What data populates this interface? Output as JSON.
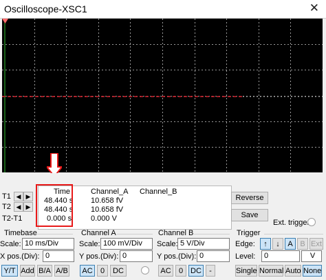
{
  "window": {
    "title": "Oscilloscope-XSC1",
    "close_glyph": "✕"
  },
  "cursors": {
    "t1_label": "T1",
    "t2_label": "T2",
    "t2t1_label": "T2-T1",
    "left_arrow": "◀",
    "right_arrow": "▶"
  },
  "readout": {
    "headers": [
      "Time",
      "Channel_A",
      "Channel_B"
    ],
    "rows": [
      {
        "time": "48.440 s",
        "channel_a": "10.658 fV",
        "channel_b": ""
      },
      {
        "time": "48.440 s",
        "channel_a": "10.658 fV",
        "channel_b": ""
      },
      {
        "time": "0.000 s",
        "channel_a": "0.000 V",
        "channel_b": ""
      }
    ]
  },
  "actions": {
    "reverse_label": "Reverse",
    "save_label": "Save",
    "ext_trigger_label": "Ext. trigger"
  },
  "timebase": {
    "title": "Timebase",
    "scale_label": "Scale:",
    "scale_value": "10 ms/Div",
    "xpos_label": "X pos.(Div):",
    "xpos_value": "0",
    "buttons": [
      "Y/T",
      "Add",
      "B/A",
      "A/B"
    ],
    "selected": "Y/T"
  },
  "channel_a": {
    "title": "Channel A",
    "scale_label": "Scale:",
    "scale_value": "100 mV/Div",
    "ypos_label": "Y pos.(Div):",
    "ypos_value": "0",
    "buttons": [
      "AC",
      "0",
      "DC"
    ],
    "selected": "AC"
  },
  "channel_b": {
    "title": "Channel B",
    "scale_label": "Scale:",
    "scale_value": "5  V/Div",
    "ypos_label": "Y pos.(Div):",
    "ypos_value": "0",
    "buttons": [
      "AC",
      "0",
      "DC",
      "-"
    ],
    "selected": "DC"
  },
  "trigger": {
    "title": "Trigger",
    "edge_label": "Edge:",
    "edge_buttons": [
      "↑",
      "↓",
      "A",
      "B",
      "Ext"
    ],
    "selected_source": "A",
    "level_label": "Level:",
    "level_value": "0",
    "level_unit": "V",
    "mode_buttons": [
      "Single",
      "Normal",
      "Auto",
      "None"
    ],
    "selected_mode": "None"
  },
  "colors": {
    "screen_bg": "#000000",
    "grid": "#9a9a9a",
    "trace": "#d0202a",
    "marker_t1": "#ff4040",
    "annotation": "#e81818"
  }
}
